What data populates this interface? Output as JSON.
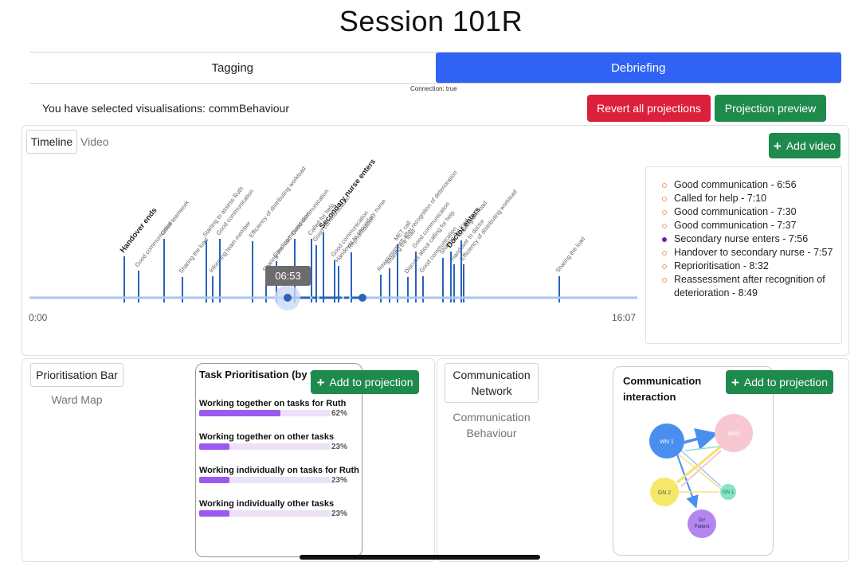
{
  "page": {
    "title": "Session 101R"
  },
  "tabs": [
    {
      "label": "Tagging",
      "active": false
    },
    {
      "label": "Debriefing",
      "active": true
    }
  ],
  "connection_text": "Connection: true",
  "selected_text": "You have selected visualisations: commBehaviour",
  "buttons": {
    "revert": "Revert all projections",
    "preview": "Projection preview",
    "add_video": "Add video",
    "add_projection": "Add to projection"
  },
  "timeline_panel": {
    "tab_timeline": "Timeline",
    "tab_video": "Video",
    "start_time": "0:00",
    "end_time": "16:07",
    "current_time": "06:53",
    "colors": {
      "line": "#a9c6ee",
      "marker": "#2a63b8",
      "accent": "#2f62f5"
    },
    "events": [
      {
        "label": "Handover ends",
        "bold": true
      },
      {
        "label": "Good communication",
        "bold": false
      },
      {
        "label": "Good teamwork",
        "bold": false
      },
      {
        "label": "Sharing the load",
        "bold": false
      },
      {
        "label": "Starting to assess Ruth",
        "bold": false
      },
      {
        "label": "Informing team member",
        "bold": false
      },
      {
        "label": "Good communication",
        "bold": false
      },
      {
        "label": "Efficiency of distributing workload",
        "bold": false
      },
      {
        "label": "Sharing the load",
        "bold": false
      },
      {
        "label": "Good communication",
        "bold": false
      },
      {
        "label": "Good communication",
        "bold": false
      },
      {
        "label": "Called for help",
        "bold": false
      },
      {
        "label": "Good communication",
        "bold": false
      },
      {
        "label": "Secondary nurse enters",
        "bold": true
      },
      {
        "label": "Good communication",
        "bold": false
      },
      {
        "label": "Handover to secondary nurse",
        "bold": false
      },
      {
        "label": "Reprioritisation",
        "bold": false
      },
      {
        "label": "Reassessment after recognition of deterioration",
        "bold": false
      },
      {
        "label": "Sharing the load",
        "bold": false
      },
      {
        "label": "MET call",
        "bold": false
      },
      {
        "label": "Discuss about calling for help",
        "bold": false
      },
      {
        "label": "Good communication",
        "bold": false
      },
      {
        "label": "Good communication",
        "bold": false
      },
      {
        "label": "Sharing the load",
        "bold": false
      },
      {
        "label": "Doctor enters",
        "bold": true
      },
      {
        "label": "Handover to doctor",
        "bold": false
      },
      {
        "label": "Sharing the load",
        "bold": false
      },
      {
        "label": "Efficiency of distributing workload",
        "bold": false
      },
      {
        "label": "Sharing the load",
        "bold": false
      }
    ]
  },
  "event_list": [
    {
      "text": "Good communication - 6:56",
      "selected": false
    },
    {
      "text": "Called for help - 7:10",
      "selected": false
    },
    {
      "text": "Good communication - 7:30",
      "selected": false
    },
    {
      "text": "Good communication - 7:37",
      "selected": false
    },
    {
      "text": "Secondary nurse enters - 7:56",
      "selected": true
    },
    {
      "text": "Handover to secondary nurse - 7:57",
      "selected": false
    },
    {
      "text": "Reprioritisation - 8:32",
      "selected": false
    },
    {
      "text": "Reassessment after recognition of deterioration - 8:49",
      "selected": false
    }
  ],
  "left_panel": {
    "tab_active": "Prioritisation Bar",
    "tab_other": "Ward Map"
  },
  "task_card": {
    "title": "Task Prioritisation (by t",
    "items": [
      {
        "label": "Working together on tasks for Ruth",
        "value": 62,
        "display": "62%"
      },
      {
        "label": "Working together on other tasks",
        "value": 23,
        "display": "23%"
      },
      {
        "label": "Working individually on tasks for Ruth",
        "value": 23,
        "display": "23%"
      },
      {
        "label": "Working individually other tasks",
        "value": 23,
        "display": "23%"
      }
    ],
    "bar_color": "#9b59f0"
  },
  "right_panel": {
    "tab_active": "Communication Network",
    "tab_other": "Communication Behaviour"
  },
  "comm_card": {
    "title": "Communication interaction",
    "nodes": [
      {
        "id": "WN 1",
        "color": "#4a8ef0"
      },
      {
        "id": "WN2",
        "color": "#f7c7d2"
      },
      {
        "id": "GN 2",
        "color": "#f5e867"
      },
      {
        "id": "GN 1",
        "color": "#86e3c3"
      },
      {
        "id": "Dr/ Patient",
        "color": "#b487f0"
      }
    ]
  }
}
